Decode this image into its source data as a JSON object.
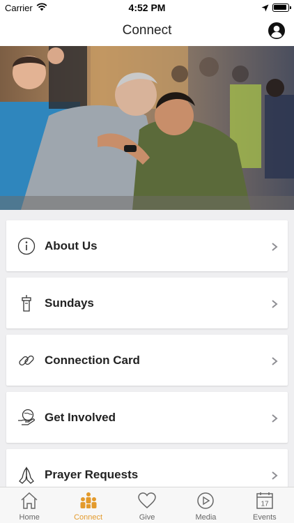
{
  "status_bar": {
    "carrier": "Carrier",
    "time": "4:52 PM"
  },
  "nav": {
    "title": "Connect"
  },
  "cards": [
    {
      "label": "About Us",
      "icon": "info-icon"
    },
    {
      "label": "Sundays",
      "icon": "pulpit-icon"
    },
    {
      "label": "Connection Card",
      "icon": "link-icon"
    },
    {
      "label": "Get Involved",
      "icon": "globe-hand-icon"
    },
    {
      "label": "Prayer Requests",
      "icon": "praying-hands-icon"
    }
  ],
  "tabs": [
    {
      "label": "Home",
      "icon": "home-icon"
    },
    {
      "label": "Connect",
      "icon": "people-icon",
      "active": true
    },
    {
      "label": "Give",
      "icon": "heart-icon"
    },
    {
      "label": "Media",
      "icon": "play-icon"
    },
    {
      "label": "Events",
      "icon": "calendar-icon",
      "date": "17"
    }
  ],
  "colors": {
    "accent": "#e39a2c",
    "background": "#efeff1",
    "card": "#ffffff"
  }
}
